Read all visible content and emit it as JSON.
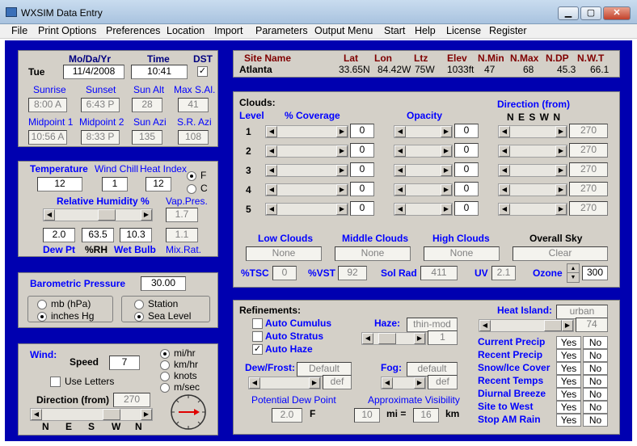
{
  "window": {
    "title": "WXSIM Data Entry",
    "min_glyph": "▁",
    "max_glyph": "▢",
    "close_glyph": "✕"
  },
  "menu": [
    "File",
    "Print Options",
    "Preferences",
    "Location",
    "Import",
    "Parameters",
    "Output Menu",
    "Start",
    "Help",
    "License",
    "Register"
  ],
  "date": {
    "header_date": "Mo/Da/Yr",
    "header_time": "Time",
    "header_dst": "DST",
    "day": "Tue",
    "date": "11/4/2008",
    "time": "10:41",
    "dst_checked": "✓"
  },
  "astro": {
    "sunrise_lbl": "Sunrise",
    "sunset_lbl": "Sunset",
    "sunalt_lbl": "Sun Alt",
    "maxsal_lbl": "Max S.Al.",
    "sunrise": "8:00 A",
    "sunset": "6:43 P",
    "sunalt": "28",
    "maxsal": "41",
    "mid1_lbl": "Midpoint 1",
    "mid2_lbl": "Midpoint 2",
    "sunazi_lbl": "Sun Azi",
    "srazi_lbl": "S.R. Azi",
    "mid1": "10:56 A",
    "mid2": "8:33 P",
    "sunazi": "135",
    "srazi": "108"
  },
  "temp": {
    "temp_lbl": "Temperature",
    "wc_lbl": "Wind Chill",
    "hi_lbl": "Heat Index",
    "f_lbl": "F",
    "c_lbl": "C",
    "temp": "12",
    "wc": "1",
    "hi": "12",
    "rh_lbl": "Relative Humidity %",
    "vp_lbl": "Vap.Pres.",
    "vp": "1.7",
    "dp": "2.0",
    "rh": "63.5",
    "wb": "10.3",
    "mr": "1.1",
    "dp_lbl": "Dew Pt",
    "rh_short": "%RH",
    "wb_lbl": "Wet Bulb",
    "mr_lbl": "Mix.Rat.",
    "rh_fraction": 0.63
  },
  "baro": {
    "label": "Barometric Pressure",
    "value": "30.00",
    "mb": "mb (hPa)",
    "inhg": "inches Hg",
    "station": "Station",
    "sea": "Sea Level"
  },
  "wind": {
    "label": "Wind:",
    "speed_lbl": "Speed",
    "speed": "7",
    "letters_lbl": "Use Letters",
    "mph": "mi/hr",
    "kmh": "km/hr",
    "knots": "knots",
    "ms": "m/sec",
    "dir_lbl": "Direction (from)",
    "dir": "270",
    "n1": "N",
    "e": "E",
    "s": "S",
    "w": "W",
    "n2": "N",
    "dir_fraction": 0.75
  },
  "site": {
    "name_lbl": "Site Name",
    "lat_lbl": "Lat",
    "lon_lbl": "Lon",
    "ltz_lbl": "Ltz",
    "elev_lbl": "Elev",
    "nmin_lbl": "N.Min",
    "nmax_lbl": "N.Max",
    "ndp_lbl": "N.DP",
    "nwt_lbl": "N.W.T",
    "name": "Atlanta",
    "lat": "33.65N",
    "lon": "84.42W",
    "ltz": "75W",
    "elev": "1033ft",
    "nmin": "47",
    "nmax": "68",
    "ndp": "45.3",
    "nwt": "66.1"
  },
  "clouds": {
    "title": "Clouds:",
    "level_lbl": "Level",
    "cov_lbl": "% Coverage",
    "opac_lbl": "Opacity",
    "dir_lbl": "Direction (from)",
    "dir_letters": "N E S W N",
    "levels": [
      {
        "n": "1",
        "cov": "0",
        "opac": "0",
        "dir": "270"
      },
      {
        "n": "2",
        "cov": "0",
        "opac": "0",
        "dir": "270"
      },
      {
        "n": "3",
        "cov": "0",
        "opac": "0",
        "dir": "270"
      },
      {
        "n": "4",
        "cov": "0",
        "opac": "0",
        "dir": "270"
      },
      {
        "n": "5",
        "cov": "0",
        "opac": "0",
        "dir": "270"
      }
    ],
    "low_lbl": "Low Clouds",
    "mid_lbl": "Middle Clouds",
    "high_lbl": "High Clouds",
    "sky_lbl": "Overall Sky",
    "low": "None",
    "mid": "None",
    "high": "None",
    "sky": "Clear",
    "tsc_lbl": "%TSC",
    "tsc": "0",
    "vst_lbl": "%VST",
    "vst": "92",
    "solrad_lbl": "Sol Rad",
    "solrad": "411",
    "uv_lbl": "UV",
    "uv": "2.1",
    "ozone_lbl": "Ozone",
    "ozone": "300"
  },
  "ref": {
    "title": "Refinements:",
    "cumulus": "Auto Cumulus",
    "stratus": "Auto Stratus",
    "haze": "Auto Haze",
    "haze_checked": "✓",
    "haze_lbl": "Haze:",
    "haze_txt": "thin-mod",
    "haze_val": "1",
    "heat_lbl": "Heat Island:",
    "heat_txt": "urban",
    "heat_val": "74",
    "dew_lbl": "Dew/Frost:",
    "dew_txt": "Default",
    "dew_val": "def",
    "fog_lbl": "Fog:",
    "fog_txt": "default",
    "fog_val": "def",
    "pdp_lbl": "Potential Dew Point",
    "pdp": "2.0",
    "pdp_unit": "F",
    "vis_lbl": "Approximate Visibility",
    "vis_mi": "10",
    "mi_eq": "mi =",
    "vis_km": "16",
    "km": "km",
    "precip": [
      {
        "label": "Current Precip",
        "yes": "Yes",
        "no": "No"
      },
      {
        "label": "Recent Precip",
        "yes": "Yes",
        "no": "No"
      },
      {
        "label": "Snow/Ice Cover",
        "yes": "Yes",
        "no": "No"
      },
      {
        "label": "Recent Temps",
        "yes": "Yes",
        "no": "No"
      },
      {
        "label": "Diurnal Breeze",
        "yes": "Yes",
        "no": "No"
      },
      {
        "label": "Site to West",
        "yes": "Yes",
        "no": "No"
      },
      {
        "label": "Stop AM Rain",
        "yes": "Yes",
        "no": "No"
      }
    ]
  }
}
